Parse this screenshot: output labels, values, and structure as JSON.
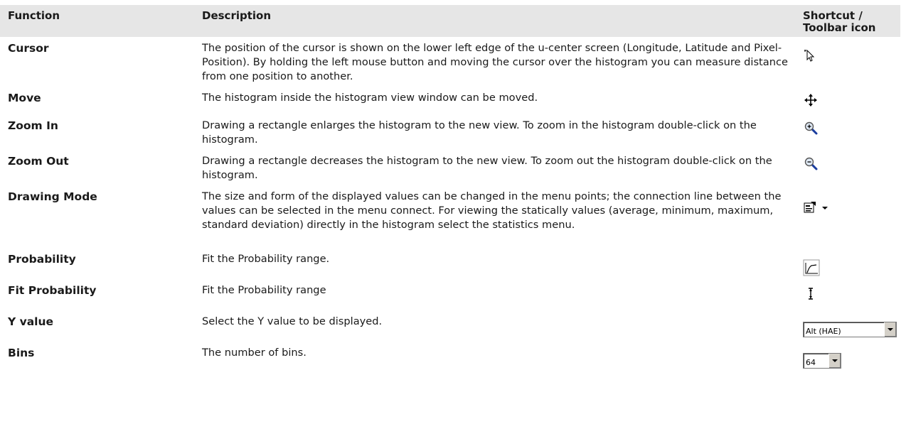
{
  "header": {
    "function": "Function",
    "description": "Description",
    "shortcut": "Shortcut / Toolbar icon"
  },
  "rows": [
    {
      "function": "Cursor",
      "description": "The position of the cursor is shown on the lower left edge of the u-center screen (Longitude, Latitude and Pixel-Position). By holding the left mouse button and moving the cursor over the histogram you can measure distance from one position to another.",
      "icon": "cursor-arrow-icon"
    },
    {
      "function": "Move",
      "description": "The histogram inside the histogram view window can be moved.",
      "icon": "move-arrows-icon"
    },
    {
      "function": "Zoom In",
      "description": "Drawing a rectangle enlarges the histogram to the new view. To zoom in the histogram double-click on the histogram.",
      "icon": "zoom-in-icon"
    },
    {
      "function": "Zoom Out",
      "description": "Drawing a rectangle decreases the histogram to the new view. To zoom out the histogram double-click on the histogram.",
      "icon": "zoom-out-icon"
    },
    {
      "function": "Drawing Mode",
      "description": "The size and form of the displayed values can be changed in the menu points; the connection line between the values can be selected in the menu connect. For viewing the statically values (average, minimum, maximum, standard deviation) directly in the histogram select the statistics menu.",
      "icon": "drawing-mode-dropdown-icon"
    },
    {
      "function": "Probability",
      "description": "Fit the Probability range.",
      "icon": "probability-curve-icon"
    },
    {
      "function": "Fit Probability",
      "description": "Fit the Probability range",
      "icon": "fit-range-icon"
    },
    {
      "function": "Y value",
      "description": "Select the Y value to be displayed.",
      "combo_value": "Alt (HAE)"
    },
    {
      "function": "Bins",
      "description": "The number of bins.",
      "combo_value": "64"
    }
  ]
}
